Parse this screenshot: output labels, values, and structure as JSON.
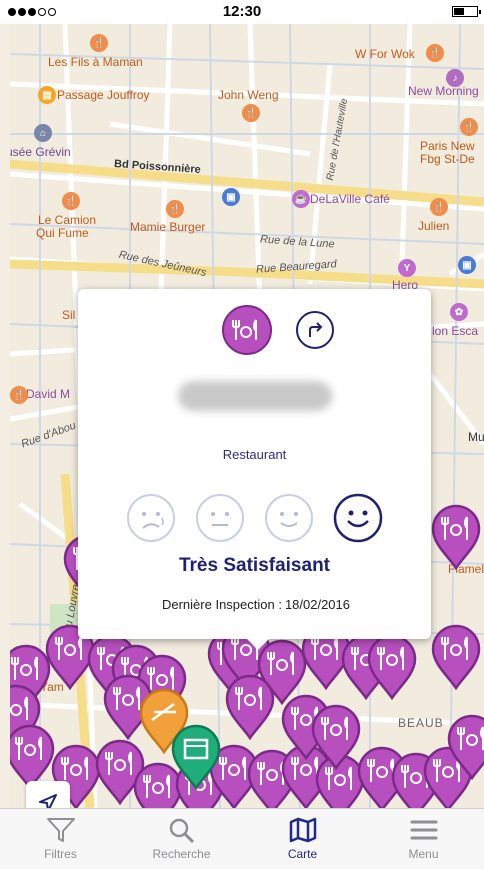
{
  "status": {
    "time": "12:30"
  },
  "map": {
    "labels": [
      {
        "text": "Les Fils à Maman",
        "cls": "o"
      },
      {
        "text": "W For Wok",
        "cls": "o"
      },
      {
        "text": "Passage Jouffroy",
        "cls": "o"
      },
      {
        "text": "John Weng",
        "cls": "o"
      },
      {
        "text": "New Morning",
        "cls": "p"
      },
      {
        "text": "usée Grévin",
        "cls": "t2"
      },
      {
        "text": "Paris New",
        "cls": "o"
      },
      {
        "text": "Fbg St-De",
        "cls": "o"
      },
      {
        "text": "Bd Poissonnière",
        "cls": "t"
      },
      {
        "text": "DeLaVille Café",
        "cls": "p"
      },
      {
        "text": "Le Camion",
        "cls": "o"
      },
      {
        "text": "Qui Fume",
        "cls": "o"
      },
      {
        "text": "Mamie Burger",
        "cls": "o"
      },
      {
        "text": "Julien",
        "cls": "o"
      },
      {
        "text": "Rue de la Lune",
        "cls": "t"
      },
      {
        "text": "Rue des Jeûneurs",
        "cls": "t"
      },
      {
        "text": "Rue Beauregard",
        "cls": "t"
      },
      {
        "text": "Hero",
        "cls": "p"
      },
      {
        "text": "Sil",
        "cls": "o"
      },
      {
        "text": "lon Esca",
        "cls": "p"
      },
      {
        "text": "David M",
        "cls": "p"
      },
      {
        "text": "Rue d'Abou",
        "cls": "t"
      },
      {
        "text": "Mu",
        "cls": "t2"
      },
      {
        "text": "Rue du Louvre",
        "cls": "t"
      },
      {
        "text": "BEAUB",
        "cls": "t2"
      },
      {
        "text": "Flamel",
        "cls": "o"
      },
      {
        "text": "Yam",
        "cls": "o"
      },
      {
        "text": "Rue de l'Hauteville",
        "cls": "t"
      }
    ]
  },
  "popup": {
    "type": "Restaurant",
    "rating": "Très Satisfaisant",
    "inspection_label": "Dernière Inspection :",
    "inspection_date": "18/02/2016",
    "faces": [
      {
        "name": "very-unsatisfied-face-icon",
        "selected": false
      },
      {
        "name": "unsatisfied-face-icon",
        "selected": false
      },
      {
        "name": "satisfied-face-icon",
        "selected": false
      },
      {
        "name": "very-satisfied-face-icon",
        "selected": true
      }
    ]
  },
  "tabbar": {
    "tabs": [
      {
        "label": "Filtres",
        "icon": "filter-icon",
        "active": false
      },
      {
        "label": "Recherche",
        "icon": "search-icon",
        "active": false
      },
      {
        "label": "Carte",
        "icon": "map-icon",
        "active": true
      },
      {
        "label": "Menu",
        "icon": "menu-icon",
        "active": false
      }
    ]
  },
  "colors": {
    "restaurant_pin": "#b84fbf",
    "pin_border": "#7b2a88",
    "brand_navy": "#1e2270",
    "orange_pin": "#f2a13a",
    "green_pin": "#1fae7a"
  }
}
